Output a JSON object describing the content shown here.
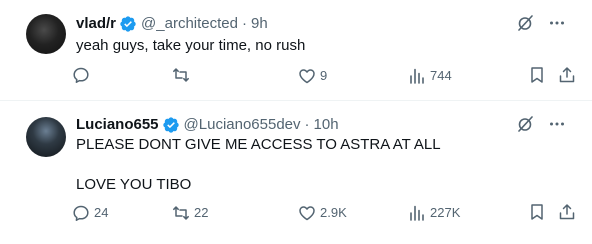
{
  "tweets": [
    {
      "name": "vlad/r",
      "handle": "@_architected",
      "separator": "·",
      "time": "9h",
      "text": "yeah guys, take your time, no rush",
      "replies": "",
      "retweets": "",
      "likes": "9",
      "views": "744"
    },
    {
      "name": "Luciano655",
      "handle": "@Luciano655dev",
      "separator": "·",
      "time": "10h",
      "text": "PLEASE DONT GIVE ME ACCESS TO ASTRA AT ALL\n\nLOVE YOU TIBO",
      "replies": "24",
      "retweets": "22",
      "likes": "2.9K",
      "views": "227K"
    }
  ],
  "colors": {
    "verified_blue": "#1d9bf0",
    "secondary_text": "#536471",
    "primary_text": "#0f1419"
  }
}
